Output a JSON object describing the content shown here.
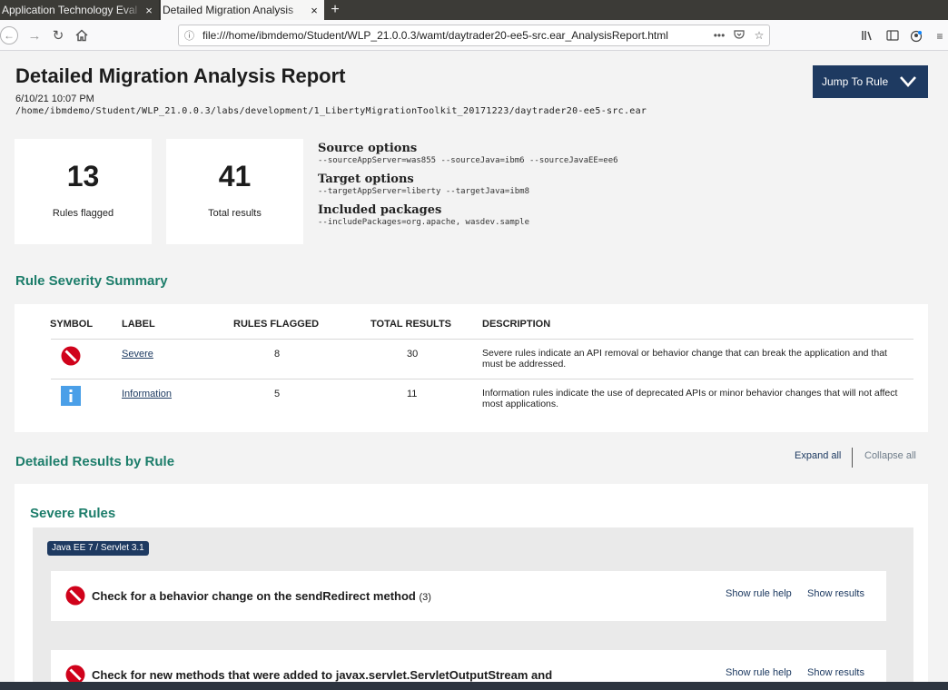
{
  "browser": {
    "tabs": [
      {
        "label": "Application Technology Eval"
      },
      {
        "label": "Detailed Migration Analysis"
      }
    ],
    "new_tab": "+",
    "close_glyph": "×",
    "url": "file:///home/ibmdemo/Student/WLP_21.0.0.3/wamt/daytrader20-ee5-src.ear_AnalysisReport.html",
    "url_more": "•••"
  },
  "report": {
    "title": "Detailed Migration Analysis Report",
    "date": "6/10/21 10:07 PM",
    "path": "/home/ibmdemo/Student/WLP_21.0.0.3/labs/development/1_LibertyMigrationToolkit_20171223/daytrader20-ee5-src.ear",
    "jump_label": "Jump To Rule"
  },
  "stats": {
    "rules_flagged": "13",
    "rules_flagged_label": "Rules flagged",
    "total_results": "41",
    "total_results_label": "Total results"
  },
  "options": {
    "source_head": "Source options",
    "source_val": "--sourceAppServer=was855 --sourceJava=ibm6 --sourceJavaEE=ee6",
    "target_head": "Target options",
    "target_val": "--targetAppServer=liberty --targetJava=ibm8",
    "packages_head": "Included packages",
    "packages_val": "--includePackages=org.apache, wasdev.sample"
  },
  "severity_summary": {
    "title": "Rule Severity Summary",
    "headers": {
      "symbol": "SYMBOL",
      "label": "LABEL",
      "rules_flagged": "RULES FLAGGED",
      "total_results": "TOTAL RESULTS",
      "description": "DESCRIPTION"
    },
    "rows": [
      {
        "icon": "severe-icon",
        "label": "Severe",
        "rules_flagged": "8",
        "total_results": "30",
        "description": "Severe rules indicate an API removal or behavior change that can break the application and that must be addressed."
      },
      {
        "icon": "info-icon",
        "label": "Information",
        "rules_flagged": "5",
        "total_results": "11",
        "description": "Information rules indicate the use of deprecated APIs or minor behavior changes that will not affect most applications."
      }
    ]
  },
  "detailed": {
    "title": "Detailed Results by Rule",
    "expand_all": "Expand all",
    "collapse_all": "Collapse all",
    "severe_title": "Severe Rules",
    "tag": "Java EE 7 / Servlet 3.1",
    "rules": [
      {
        "title": "Check for a behavior change on the sendRedirect method",
        "count": "(3)",
        "help": "Show rule help",
        "results": "Show results"
      },
      {
        "title": "Check for new methods that were added to javax.servlet.ServletOutputStream and",
        "count": "",
        "help": "Show rule help",
        "results": "Show results"
      }
    ]
  },
  "colors": {
    "accent": "#1c7d6a",
    "navy": "#1e3a61",
    "severe": "#d0021b",
    "info": "#4a9fe8"
  }
}
